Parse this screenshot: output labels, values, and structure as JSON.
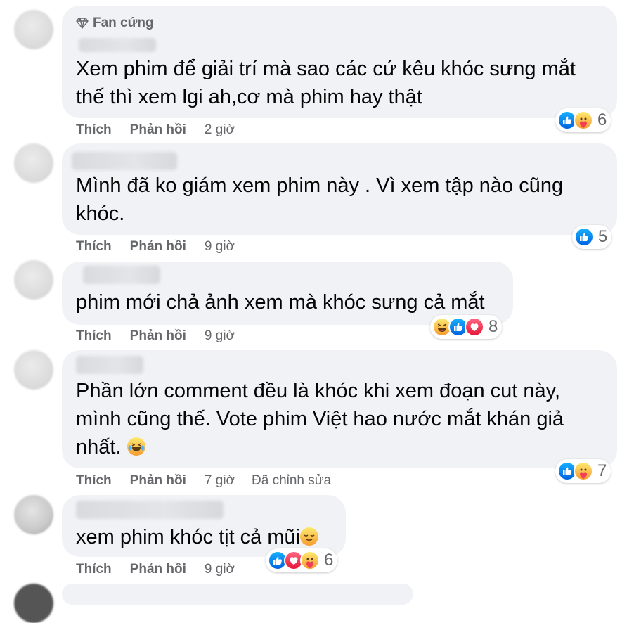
{
  "colors": {
    "bubble": "#f0f2f5",
    "text": "#050505",
    "meta": "#65676b",
    "like": "#1877f2",
    "love": "#f33e58"
  },
  "comments": [
    {
      "badge": "Fan cứng",
      "badge_icon": "diamond-icon",
      "lines": [
        "Xem phim để giải trí mà sao các cứ kêu khóc sưng mắt",
        "thế thì xem lgi ah,cơ mà phim hay thật"
      ],
      "like_label": "Thích",
      "reply_label": "Phản hồi",
      "time": "2 giờ",
      "reactions": [
        "like-icon",
        "care-icon"
      ],
      "reaction_count": "6"
    },
    {
      "lines": [
        "Mình đã ko giám xem phim này . Vì xem tập nào cũng",
        "khóc."
      ],
      "like_label": "Thích",
      "reply_label": "Phản hồi",
      "time": "9 giờ",
      "reactions": [
        "like-icon"
      ],
      "reaction_count": "5"
    },
    {
      "lines": [
        "phim mới chả ảnh xem mà khóc sưng cả mắt"
      ],
      "like_label": "Thích",
      "reply_label": "Phản hồi",
      "time": "9 giờ",
      "reactions": [
        "haha-icon",
        "like-icon",
        "love-icon"
      ],
      "reaction_count": "8"
    },
    {
      "lines": [
        "Phần lớn comment đều là khóc khi xem đoạn cut này,",
        "mình cũng thế. Vote phim Việt hao nước mắt khán giả",
        "nhất."
      ],
      "inline_emoji": "crying-laughing-emoji",
      "like_label": "Thích",
      "reply_label": "Phản hồi",
      "time": "7 giờ",
      "edited_label": "Đã chỉnh sửa",
      "reactions": [
        "like-icon",
        "care-icon"
      ],
      "reaction_count": "7"
    },
    {
      "lines": [
        "xem phim khóc tịt cả mũi"
      ],
      "inline_emoji": "relieved-emoji",
      "like_label": "Thích",
      "reply_label": "Phản hồi",
      "time": "9 giờ",
      "reactions": [
        "like-icon",
        "love-icon",
        "care-icon"
      ],
      "reaction_count": "6"
    }
  ]
}
